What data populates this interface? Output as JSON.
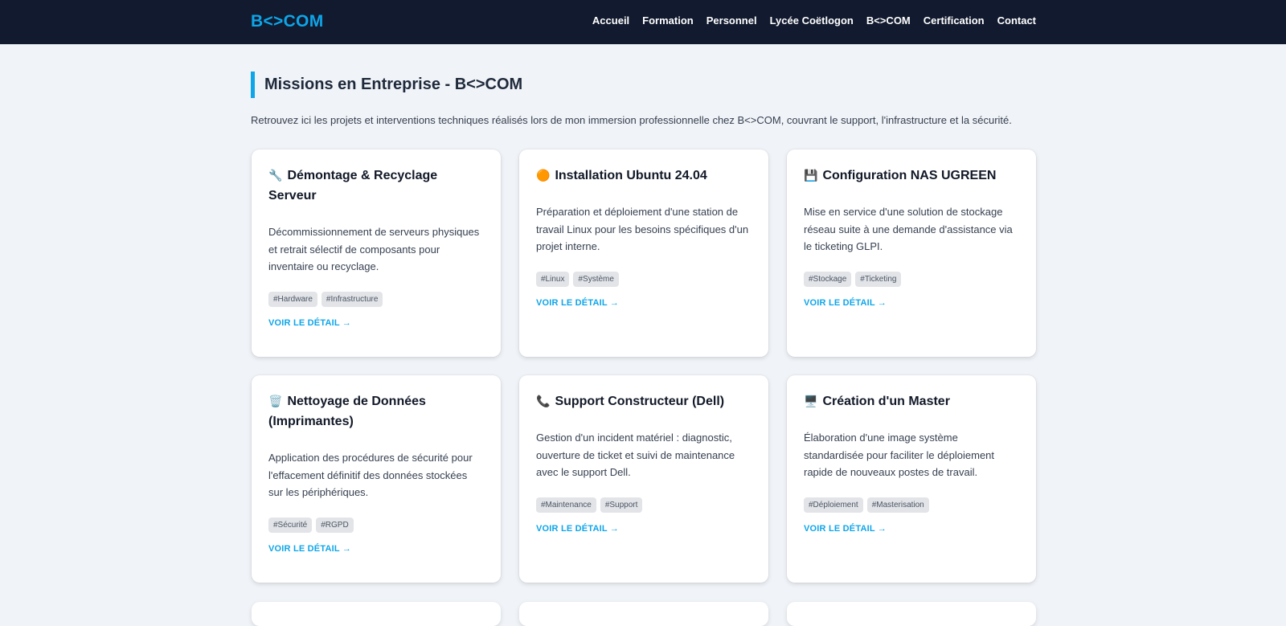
{
  "nav": {
    "brand": "B<>COM",
    "links": [
      "Accueil",
      "Formation",
      "Personnel",
      "Lycée Coëtlogon",
      "B<>COM",
      "Certification",
      "Contact"
    ]
  },
  "page": {
    "title": "Missions en Entreprise - B<>COM",
    "intro": "Retrouvez ici les projets et interventions techniques réalisés lors de mon immersion professionnelle chez B<>COM, couvrant le support, l'infrastructure et la sécurité."
  },
  "cards": [
    {
      "icon": "🔧",
      "title": "Démontage & Recyclage Serveur",
      "desc": "Décommissionnement de serveurs physiques et retrait sélectif de composants pour inventaire ou recyclage.",
      "tags": [
        "#Hardware",
        "#Infrastructure"
      ],
      "link": "VOIR LE DÉTAIL →"
    },
    {
      "icon": "🟠",
      "title": "Installation Ubuntu 24.04",
      "desc": "Préparation et déploiement d'une station de travail Linux pour les besoins spécifiques d'un projet interne.",
      "tags": [
        "#Linux",
        "#Système"
      ],
      "link": "VOIR LE DÉTAIL →"
    },
    {
      "icon": "💾",
      "title": "Configuration NAS UGREEN",
      "desc": "Mise en service d'une solution de stockage réseau suite à une demande d'assistance via le ticketing GLPI.",
      "tags": [
        "#Stockage",
        "#Ticketing"
      ],
      "link": "VOIR LE DÉTAIL →"
    },
    {
      "icon": "🗑️",
      "title": "Nettoyage de Données (Imprimantes)",
      "desc": "Application des procédures de sécurité pour l'effacement définitif des données stockées sur les périphériques.",
      "tags": [
        "#Sécurité",
        "#RGPD"
      ],
      "link": "VOIR LE DÉTAIL →"
    },
    {
      "icon": "📞",
      "title": "Support Constructeur (Dell)",
      "desc": "Gestion d'un incident matériel : diagnostic, ouverture de ticket et suivi de maintenance avec le support Dell.",
      "tags": [
        "#Maintenance",
        "#Support"
      ],
      "link": "VOIR LE DÉTAIL →"
    },
    {
      "icon": "🖥️",
      "title": "Création d'un Master",
      "desc": "Élaboration d'une image système standardisée pour faciliter le déploiement rapide de nouveaux postes de travail.",
      "tags": [
        "#Déploiement",
        "#Masterisation"
      ],
      "link": "VOIR LE DÉTAIL →"
    }
  ]
}
